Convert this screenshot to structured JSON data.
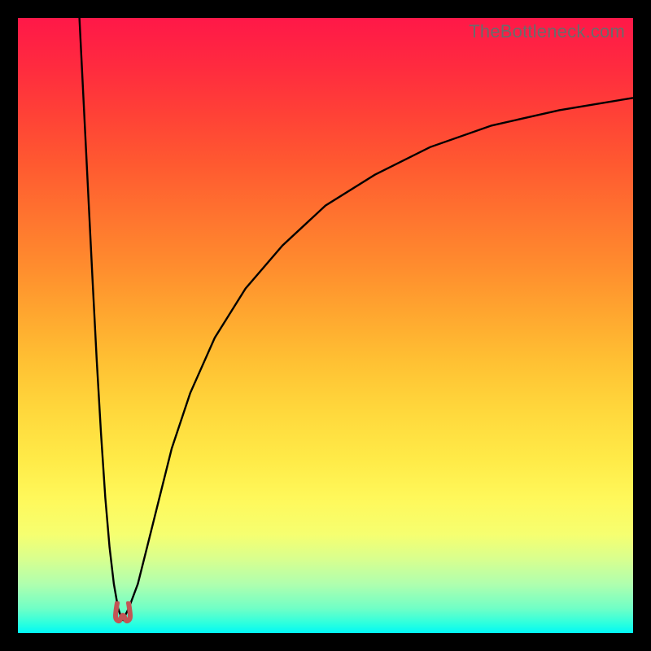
{
  "watermark": "TheBottleneck.com",
  "colors": {
    "frame": "#000000",
    "curve": "#000000",
    "marker": "#c25555",
    "gradient_top": "#ff1848",
    "gradient_bottom": "#00f8f6"
  },
  "chart_data": {
    "type": "line",
    "title": "",
    "xlabel": "",
    "ylabel": "",
    "xlim": [
      0,
      100
    ],
    "ylim": [
      0,
      100
    ],
    "grid": false,
    "legend": false,
    "minimum_marker": {
      "x": 17,
      "y": 2
    },
    "series": [
      {
        "name": "left-branch",
        "x": [
          10.0,
          10.7,
          11.4,
          12.1,
          12.8,
          13.5,
          14.2,
          14.9,
          15.6,
          16.3,
          17.0
        ],
        "y": [
          100.0,
          86.0,
          72.0,
          58.0,
          44.5,
          32.5,
          22.0,
          14.0,
          8.0,
          4.0,
          2.0
        ]
      },
      {
        "name": "right-branch",
        "x": [
          17.0,
          18.0,
          19.5,
          21.0,
          23.0,
          25.0,
          28.0,
          32.0,
          37.0,
          43.0,
          50.0,
          58.0,
          67.0,
          77.0,
          88.0,
          100.0
        ],
        "y": [
          2.0,
          4.0,
          8.0,
          14.0,
          22.0,
          30.0,
          39.0,
          48.0,
          56.0,
          63.0,
          69.5,
          74.5,
          79.0,
          82.5,
          85.0,
          87.0
        ]
      }
    ]
  }
}
